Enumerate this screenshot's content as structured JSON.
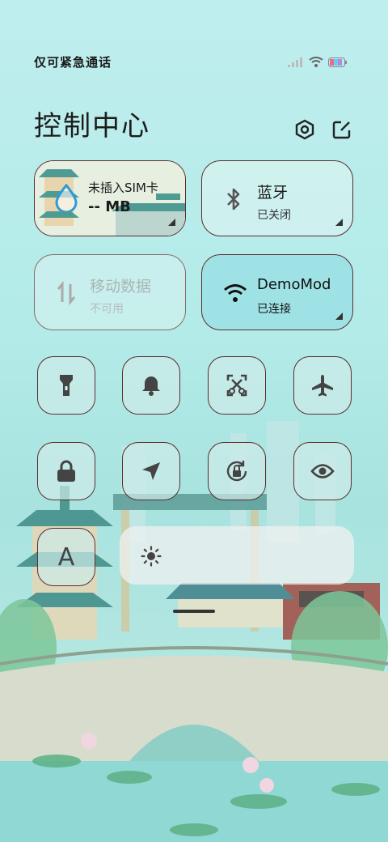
{
  "status_bar": {
    "carrier_text": "仅可紧急通话",
    "signal_icon": "signal-icon",
    "wifi_icon": "wifi-icon",
    "battery_icon": "battery-icon"
  },
  "header": {
    "title": "控制中心",
    "settings_icon": "gear-icon",
    "edit_icon": "edit-icon"
  },
  "tiles": [
    {
      "id": "data-usage",
      "label": "未插入SIM卡",
      "sub": "-- MB",
      "icon": "water-drop-icon"
    },
    {
      "id": "bluetooth",
      "label": "蓝牙",
      "sub": "已关闭",
      "icon": "bluetooth-icon"
    },
    {
      "id": "mobile-data",
      "label": "移动数据",
      "sub": "不可用",
      "icon": "mobile-data-icon"
    },
    {
      "id": "wifi",
      "label": "DemoMod",
      "sub": "已连接",
      "icon": "wifi-icon"
    }
  ],
  "toggles_row1": [
    "flashlight-icon",
    "bell-icon",
    "screenshot-icon",
    "airplane-icon"
  ],
  "toggles_row2": [
    "lock-icon",
    "location-icon",
    "rotation-lock-icon",
    "eye-icon"
  ],
  "font_toggle": {
    "label": "A"
  },
  "brightness": {
    "icon": "brightness-icon"
  },
  "colors": {
    "accent": "#2e9bd6",
    "border": "#5a2e2e",
    "wifi_active": "#9fe2e6"
  }
}
